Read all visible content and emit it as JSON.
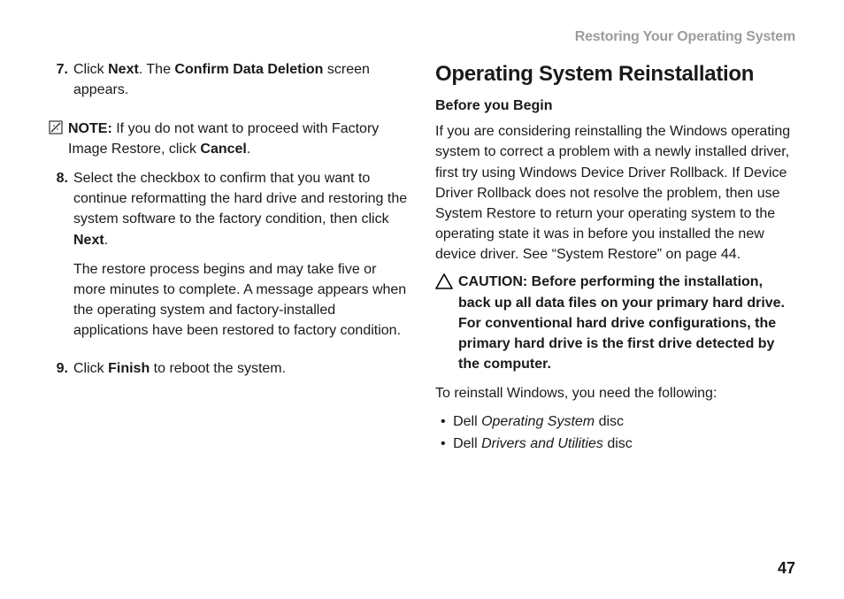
{
  "running_header": "Restoring Your Operating System",
  "page_number": "47",
  "left": {
    "step7_num": "7.",
    "step7_a": "Click ",
    "step7_b": "Next",
    "step7_c": ". The ",
    "step7_d": "Confirm Data Deletion",
    "step7_e": " screen appears.",
    "note_label": "NOTE:",
    "note_a": " If you do not want to proceed with Factory Image Restore, click ",
    "note_b": "Cancel",
    "note_c": ".",
    "step8_num": "8.",
    "step8_a": "Select the checkbox to confirm that you want to continue reformatting the hard drive and restoring the system software to the factory condition, then click ",
    "step8_b": "Next",
    "step8_c": ".",
    "step8_p2": "The restore process begins and may take five or more minutes to complete. A message appears when the operating system and factory-installed applications have been restored to factory condition.",
    "step9_num": "9.",
    "step9_a": "Click ",
    "step9_b": "Finish",
    "step9_c": " to reboot the system."
  },
  "right": {
    "heading": "Operating System Reinstallation",
    "subheading": "Before you Begin",
    "para1": "If you are considering reinstalling the Windows operating system to correct a problem with a newly installed driver, first try using Windows Device Driver Rollback. If Device Driver Rollback does not resolve the problem, then use System Restore to return your operating system to the operating state it was in before you installed the new device driver. See “System Restore” on page 44.",
    "caution": "CAUTION: Before performing the installation, back up all data files on your primary hard drive. For conventional hard drive configurations, the primary hard drive is the first drive detected by the computer.",
    "para2": "To reinstall Windows, you need the following:",
    "bullet1_a": "Dell ",
    "bullet1_b": "Operating System",
    "bullet1_c": " disc",
    "bullet2_a": "Dell ",
    "bullet2_b": "Drivers and Utilities",
    "bullet2_c": " disc"
  }
}
